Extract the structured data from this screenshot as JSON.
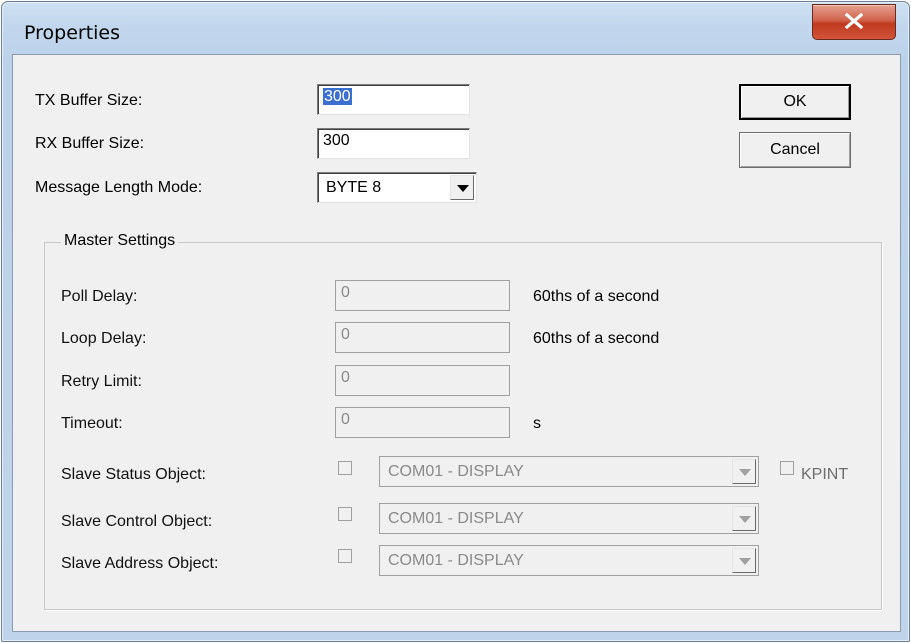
{
  "window": {
    "title": "Properties"
  },
  "fields": {
    "tx_label": "TX Buffer Size:",
    "tx_value": "300",
    "rx_label": "RX Buffer Size:",
    "rx_value": "300",
    "mode_label": "Message Length Mode:",
    "mode_value": "BYTE 8"
  },
  "buttons": {
    "ok": "OK",
    "cancel": "Cancel"
  },
  "master": {
    "legend": "Master Settings",
    "poll_label": "Poll Delay:",
    "poll_value": "0",
    "poll_unit": "60ths of a second",
    "loop_label": "Loop Delay:",
    "loop_value": "0",
    "loop_unit": "60ths of a second",
    "retry_label": "Retry Limit:",
    "retry_value": "0",
    "timeout_label": "Timeout:",
    "timeout_value": "0",
    "timeout_unit": "s",
    "status_label": "Slave Status Object:",
    "status_value": "COM01 - DISPLAY",
    "kpint_label": "KPINT",
    "control_label": "Slave Control Object:",
    "control_value": "COM01 - DISPLAY",
    "address_label": "Slave Address Object:",
    "address_value": "COM01 - DISPLAY"
  },
  "icons": {
    "close": "close-icon",
    "dropdown": "chevron-down-icon"
  }
}
